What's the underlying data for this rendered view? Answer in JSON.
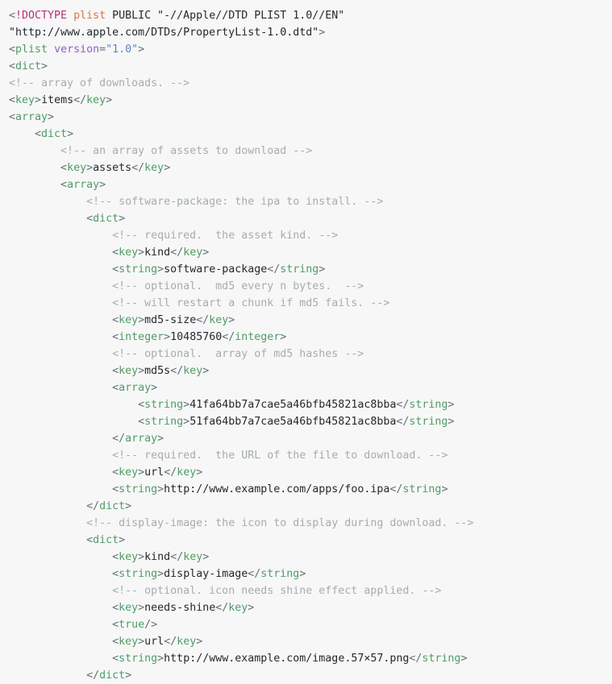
{
  "document": {
    "language": "xml-plist",
    "title": "Apple Property List (plist) XML source",
    "background_color": "#f7f7f7",
    "colors": {
      "punctuation": "#62707a",
      "tag": "#4f9c68",
      "text": "#24292e",
      "comment": "#a6adad",
      "doctype_keyword": "#b5317b",
      "doctype_name": "#d9744a",
      "attribute_name": "#8a62c0",
      "attribute_value": "#5f82c4"
    },
    "indent_unit_spaces": 4,
    "line_count": 40,
    "lines": [
      {
        "n": 1,
        "indent": 0,
        "tokens": [
          {
            "kind": "punct",
            "text": "<"
          },
          {
            "kind": "doctype",
            "text": "!DOCTYPE"
          },
          {
            "kind": "doctype-text",
            "text": " "
          },
          {
            "kind": "doctype-name",
            "text": "plist"
          },
          {
            "kind": "doctype-text",
            "text": " PUBLIC \"-//Apple//DTD PLIST 1.0//EN\""
          }
        ]
      },
      {
        "n": 2,
        "indent": 0,
        "tokens": [
          {
            "kind": "doctype-text",
            "text": "\"http://www.apple.com/DTDs/PropertyList-1.0.dtd\""
          },
          {
            "kind": "punct",
            "text": ">"
          }
        ]
      },
      {
        "n": 3,
        "indent": 0,
        "tokens": [
          {
            "kind": "punct",
            "text": "<"
          },
          {
            "kind": "tag",
            "text": "plist"
          },
          {
            "kind": "text",
            "text": " "
          },
          {
            "kind": "attr",
            "text": "version"
          },
          {
            "kind": "punct",
            "text": "="
          },
          {
            "kind": "attrval",
            "text": "\"1.0\""
          },
          {
            "kind": "punct",
            "text": ">"
          }
        ]
      },
      {
        "n": 4,
        "indent": 0,
        "tokens": [
          {
            "kind": "punct",
            "text": "<"
          },
          {
            "kind": "tag",
            "text": "dict"
          },
          {
            "kind": "punct",
            "text": ">"
          }
        ]
      },
      {
        "n": 5,
        "indent": 0,
        "tokens": [
          {
            "kind": "comment",
            "text": "<!-- array of downloads. -->"
          }
        ]
      },
      {
        "n": 6,
        "indent": 0,
        "tokens": [
          {
            "kind": "punct",
            "text": "<"
          },
          {
            "kind": "tag",
            "text": "key"
          },
          {
            "kind": "punct",
            "text": ">"
          },
          {
            "kind": "text",
            "text": "items"
          },
          {
            "kind": "punct",
            "text": "</"
          },
          {
            "kind": "tag",
            "text": "key"
          },
          {
            "kind": "punct",
            "text": ">"
          }
        ]
      },
      {
        "n": 7,
        "indent": 0,
        "tokens": [
          {
            "kind": "punct",
            "text": "<"
          },
          {
            "kind": "tag",
            "text": "array"
          },
          {
            "kind": "punct",
            "text": ">"
          }
        ]
      },
      {
        "n": 8,
        "indent": 1,
        "tokens": [
          {
            "kind": "punct",
            "text": "<"
          },
          {
            "kind": "tag",
            "text": "dict"
          },
          {
            "kind": "punct",
            "text": ">"
          }
        ]
      },
      {
        "n": 9,
        "indent": 2,
        "tokens": [
          {
            "kind": "comment",
            "text": "<!-- an array of assets to download -->"
          }
        ]
      },
      {
        "n": 10,
        "indent": 2,
        "tokens": [
          {
            "kind": "punct",
            "text": "<"
          },
          {
            "kind": "tag",
            "text": "key"
          },
          {
            "kind": "punct",
            "text": ">"
          },
          {
            "kind": "text",
            "text": "assets"
          },
          {
            "kind": "punct",
            "text": "</"
          },
          {
            "kind": "tag",
            "text": "key"
          },
          {
            "kind": "punct",
            "text": ">"
          }
        ]
      },
      {
        "n": 11,
        "indent": 2,
        "tokens": [
          {
            "kind": "punct",
            "text": "<"
          },
          {
            "kind": "tag",
            "text": "array"
          },
          {
            "kind": "punct",
            "text": ">"
          }
        ]
      },
      {
        "n": 12,
        "indent": 3,
        "tokens": [
          {
            "kind": "comment",
            "text": "<!-- software-package: the ipa to install. -->"
          }
        ]
      },
      {
        "n": 13,
        "indent": 3,
        "tokens": [
          {
            "kind": "punct",
            "text": "<"
          },
          {
            "kind": "tag",
            "text": "dict"
          },
          {
            "kind": "punct",
            "text": ">"
          }
        ]
      },
      {
        "n": 14,
        "indent": 4,
        "tokens": [
          {
            "kind": "comment",
            "text": "<!-- required.  the asset kind. -->"
          }
        ]
      },
      {
        "n": 15,
        "indent": 4,
        "tokens": [
          {
            "kind": "punct",
            "text": "<"
          },
          {
            "kind": "tag",
            "text": "key"
          },
          {
            "kind": "punct",
            "text": ">"
          },
          {
            "kind": "text",
            "text": "kind"
          },
          {
            "kind": "punct",
            "text": "</"
          },
          {
            "kind": "tag",
            "text": "key"
          },
          {
            "kind": "punct",
            "text": ">"
          }
        ]
      },
      {
        "n": 16,
        "indent": 4,
        "tokens": [
          {
            "kind": "punct",
            "text": "<"
          },
          {
            "kind": "tag",
            "text": "string"
          },
          {
            "kind": "punct",
            "text": ">"
          },
          {
            "kind": "text",
            "text": "software-package"
          },
          {
            "kind": "punct",
            "text": "</"
          },
          {
            "kind": "tag",
            "text": "string"
          },
          {
            "kind": "punct",
            "text": ">"
          }
        ]
      },
      {
        "n": 17,
        "indent": 4,
        "tokens": [
          {
            "kind": "comment",
            "text": "<!-- optional.  md5 every n bytes.  -->"
          }
        ]
      },
      {
        "n": 18,
        "indent": 4,
        "tokens": [
          {
            "kind": "comment",
            "text": "<!-- will restart a chunk if md5 fails. -->"
          }
        ]
      },
      {
        "n": 19,
        "indent": 4,
        "tokens": [
          {
            "kind": "punct",
            "text": "<"
          },
          {
            "kind": "tag",
            "text": "key"
          },
          {
            "kind": "punct",
            "text": ">"
          },
          {
            "kind": "text",
            "text": "md5-size"
          },
          {
            "kind": "punct",
            "text": "</"
          },
          {
            "kind": "tag",
            "text": "key"
          },
          {
            "kind": "punct",
            "text": ">"
          }
        ]
      },
      {
        "n": 20,
        "indent": 4,
        "tokens": [
          {
            "kind": "punct",
            "text": "<"
          },
          {
            "kind": "tag",
            "text": "integer"
          },
          {
            "kind": "punct",
            "text": ">"
          },
          {
            "kind": "text",
            "text": "10485760"
          },
          {
            "kind": "punct",
            "text": "</"
          },
          {
            "kind": "tag",
            "text": "integer"
          },
          {
            "kind": "punct",
            "text": ">"
          }
        ]
      },
      {
        "n": 21,
        "indent": 4,
        "tokens": [
          {
            "kind": "comment",
            "text": "<!-- optional.  array of md5 hashes -->"
          }
        ]
      },
      {
        "n": 22,
        "indent": 4,
        "tokens": [
          {
            "kind": "punct",
            "text": "<"
          },
          {
            "kind": "tag",
            "text": "key"
          },
          {
            "kind": "punct",
            "text": ">"
          },
          {
            "kind": "text",
            "text": "md5s"
          },
          {
            "kind": "punct",
            "text": "</"
          },
          {
            "kind": "tag",
            "text": "key"
          },
          {
            "kind": "punct",
            "text": ">"
          }
        ]
      },
      {
        "n": 23,
        "indent": 4,
        "tokens": [
          {
            "kind": "punct",
            "text": "<"
          },
          {
            "kind": "tag",
            "text": "array"
          },
          {
            "kind": "punct",
            "text": ">"
          }
        ]
      },
      {
        "n": 24,
        "indent": 5,
        "tokens": [
          {
            "kind": "punct",
            "text": "<"
          },
          {
            "kind": "tag",
            "text": "string"
          },
          {
            "kind": "punct",
            "text": ">"
          },
          {
            "kind": "text",
            "text": "41fa64bb7a7cae5a46bfb45821ac8bba"
          },
          {
            "kind": "punct",
            "text": "</"
          },
          {
            "kind": "tag",
            "text": "string"
          },
          {
            "kind": "punct",
            "text": ">"
          }
        ]
      },
      {
        "n": 25,
        "indent": 5,
        "tokens": [
          {
            "kind": "punct",
            "text": "<"
          },
          {
            "kind": "tag",
            "text": "string"
          },
          {
            "kind": "punct",
            "text": ">"
          },
          {
            "kind": "text",
            "text": "51fa64bb7a7cae5a46bfb45821ac8bba"
          },
          {
            "kind": "punct",
            "text": "</"
          },
          {
            "kind": "tag",
            "text": "string"
          },
          {
            "kind": "punct",
            "text": ">"
          }
        ]
      },
      {
        "n": 26,
        "indent": 4,
        "tokens": [
          {
            "kind": "punct",
            "text": "</"
          },
          {
            "kind": "tag",
            "text": "array"
          },
          {
            "kind": "punct",
            "text": ">"
          }
        ]
      },
      {
        "n": 27,
        "indent": 4,
        "tokens": [
          {
            "kind": "comment",
            "text": "<!-- required.  the URL of the file to download. -->"
          }
        ]
      },
      {
        "n": 28,
        "indent": 4,
        "tokens": [
          {
            "kind": "punct",
            "text": "<"
          },
          {
            "kind": "tag",
            "text": "key"
          },
          {
            "kind": "punct",
            "text": ">"
          },
          {
            "kind": "text",
            "text": "url"
          },
          {
            "kind": "punct",
            "text": "</"
          },
          {
            "kind": "tag",
            "text": "key"
          },
          {
            "kind": "punct",
            "text": ">"
          }
        ]
      },
      {
        "n": 29,
        "indent": 4,
        "tokens": [
          {
            "kind": "punct",
            "text": "<"
          },
          {
            "kind": "tag",
            "text": "string"
          },
          {
            "kind": "punct",
            "text": ">"
          },
          {
            "kind": "text",
            "text": "http://www.example.com/apps/foo.ipa"
          },
          {
            "kind": "punct",
            "text": "</"
          },
          {
            "kind": "tag",
            "text": "string"
          },
          {
            "kind": "punct",
            "text": ">"
          }
        ]
      },
      {
        "n": 30,
        "indent": 3,
        "tokens": [
          {
            "kind": "punct",
            "text": "</"
          },
          {
            "kind": "tag",
            "text": "dict"
          },
          {
            "kind": "punct",
            "text": ">"
          }
        ]
      },
      {
        "n": 31,
        "indent": 3,
        "tokens": [
          {
            "kind": "comment",
            "text": "<!-- display-image: the icon to display during download. -->"
          }
        ]
      },
      {
        "n": 32,
        "indent": 3,
        "tokens": [
          {
            "kind": "punct",
            "text": "<"
          },
          {
            "kind": "tag",
            "text": "dict"
          },
          {
            "kind": "punct",
            "text": ">"
          }
        ]
      },
      {
        "n": 33,
        "indent": 4,
        "tokens": [
          {
            "kind": "punct",
            "text": "<"
          },
          {
            "kind": "tag",
            "text": "key"
          },
          {
            "kind": "punct",
            "text": ">"
          },
          {
            "kind": "text",
            "text": "kind"
          },
          {
            "kind": "punct",
            "text": "</"
          },
          {
            "kind": "tag",
            "text": "key"
          },
          {
            "kind": "punct",
            "text": ">"
          }
        ]
      },
      {
        "n": 34,
        "indent": 4,
        "tokens": [
          {
            "kind": "punct",
            "text": "<"
          },
          {
            "kind": "tag",
            "text": "string"
          },
          {
            "kind": "punct",
            "text": ">"
          },
          {
            "kind": "text",
            "text": "display-image"
          },
          {
            "kind": "punct",
            "text": "</"
          },
          {
            "kind": "tag",
            "text": "string"
          },
          {
            "kind": "punct",
            "text": ">"
          }
        ]
      },
      {
        "n": 35,
        "indent": 4,
        "tokens": [
          {
            "kind": "comment",
            "text": "<!-- optional. icon needs shine effect applied. -->"
          }
        ]
      },
      {
        "n": 36,
        "indent": 4,
        "tokens": [
          {
            "kind": "punct",
            "text": "<"
          },
          {
            "kind": "tag",
            "text": "key"
          },
          {
            "kind": "punct",
            "text": ">"
          },
          {
            "kind": "text",
            "text": "needs-shine"
          },
          {
            "kind": "punct",
            "text": "</"
          },
          {
            "kind": "tag",
            "text": "key"
          },
          {
            "kind": "punct",
            "text": ">"
          }
        ]
      },
      {
        "n": 37,
        "indent": 4,
        "tokens": [
          {
            "kind": "punct",
            "text": "<"
          },
          {
            "kind": "tag",
            "text": "true"
          },
          {
            "kind": "punct",
            "text": "/>"
          }
        ]
      },
      {
        "n": 38,
        "indent": 4,
        "tokens": [
          {
            "kind": "punct",
            "text": "<"
          },
          {
            "kind": "tag",
            "text": "key"
          },
          {
            "kind": "punct",
            "text": ">"
          },
          {
            "kind": "text",
            "text": "url"
          },
          {
            "kind": "punct",
            "text": "</"
          },
          {
            "kind": "tag",
            "text": "key"
          },
          {
            "kind": "punct",
            "text": ">"
          }
        ]
      },
      {
        "n": 39,
        "indent": 4,
        "tokens": [
          {
            "kind": "punct",
            "text": "<"
          },
          {
            "kind": "tag",
            "text": "string"
          },
          {
            "kind": "punct",
            "text": ">"
          },
          {
            "kind": "text",
            "text": "http://www.example.com/image.57×57.png"
          },
          {
            "kind": "punct",
            "text": "</"
          },
          {
            "kind": "tag",
            "text": "string"
          },
          {
            "kind": "punct",
            "text": ">"
          }
        ]
      },
      {
        "n": 40,
        "indent": 3,
        "tokens": [
          {
            "kind": "punct",
            "text": "</"
          },
          {
            "kind": "tag",
            "text": "dict"
          },
          {
            "kind": "punct",
            "text": ">"
          }
        ]
      }
    ]
  }
}
